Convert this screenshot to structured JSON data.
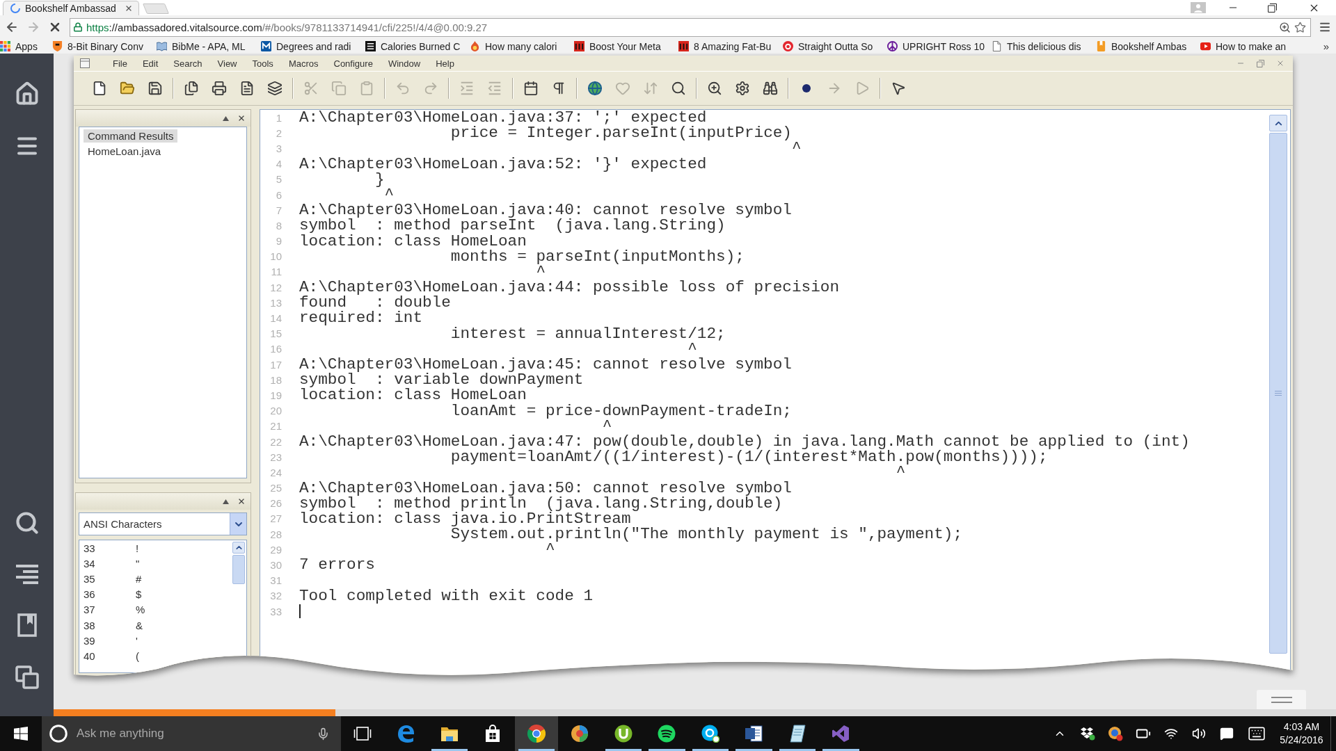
{
  "browser": {
    "tabs": [
      {
        "title": "Bookshelf Ambassad",
        "selected": true,
        "loading": true
      }
    ],
    "url": {
      "scheme": "https",
      "host": "://ambassadored.vitalsource.com",
      "path": "/#/books/9781133714941/cfi/225!/4/4@0.00:9.27"
    },
    "bookmarks": [
      {
        "kind": "apps",
        "label": "Apps"
      },
      {
        "kind": "site",
        "label": "8-Bit Binary Conv"
      },
      {
        "kind": "site",
        "label": "BibMe - APA, ML"
      },
      {
        "kind": "site",
        "label": "Degrees and radi"
      },
      {
        "kind": "site",
        "label": "Calories Burned C"
      },
      {
        "kind": "site",
        "label": "How many calori"
      },
      {
        "kind": "site",
        "label": "Boost Your Meta"
      },
      {
        "kind": "site",
        "label": "8 Amazing Fat-Bu"
      },
      {
        "kind": "site",
        "label": "Straight Outta So"
      },
      {
        "kind": "site",
        "label": "UPRIGHT Ross 10"
      },
      {
        "kind": "site",
        "label": "This delicious dis"
      },
      {
        "kind": "site",
        "label": "Bookshelf Ambas"
      },
      {
        "kind": "site",
        "label": "How to make an"
      }
    ],
    "bookmarks_overflow": "»"
  },
  "reader": {
    "progress": {
      "level": 0.22
    }
  },
  "ide": {
    "menu": [
      "File",
      "Edit",
      "Search",
      "View",
      "Tools",
      "Macros",
      "Configure",
      "Window",
      "Help"
    ],
    "toolbar_groups": [
      [
        {
          "disabled": false
        },
        {
          "disabled": false
        },
        {
          "disabled": false
        }
      ],
      [
        {
          "disabled": false
        },
        {
          "disabled": false
        },
        {
          "disabled": false
        },
        {
          "disabled": false
        }
      ],
      [
        {
          "disabled": true
        },
        {
          "disabled": true
        },
        {
          "disabled": true
        }
      ],
      [
        {
          "disabled": true
        },
        {
          "disabled": true
        }
      ],
      [
        {
          "disabled": true
        },
        {
          "disabled": true
        }
      ],
      [
        {
          "disabled": false
        },
        {
          "disabled": false
        }
      ],
      [
        {
          "disabled": false
        },
        {
          "disabled": true
        },
        {
          "disabled": true
        },
        {
          "disabled": false
        }
      ],
      [
        {
          "disabled": false
        },
        {
          "disabled": false
        },
        {
          "disabled": false
        }
      ],
      [
        {
          "disabled": false
        },
        {
          "disabled": true
        },
        {
          "disabled": true
        }
      ],
      [
        {
          "disabled": false
        }
      ]
    ],
    "file_view": {
      "items": [
        {
          "label": "Command Results",
          "selected": true
        },
        {
          "label": "HomeLoan.java",
          "selected": false
        }
      ]
    },
    "character_map": {
      "selector": "ANSI Characters",
      "rows": [
        {
          "code": "33",
          "char": "!"
        },
        {
          "code": "34",
          "char": "\""
        },
        {
          "code": "35",
          "char": "#"
        },
        {
          "code": "36",
          "char": "$"
        },
        {
          "code": "37",
          "char": "%"
        },
        {
          "code": "38",
          "char": "&"
        },
        {
          "code": "39",
          "char": "'"
        },
        {
          "code": "40",
          "char": "("
        }
      ]
    },
    "output": {
      "lines": [
        {
          "number": "1",
          "text": "A:\\Chapter03\\HomeLoan.java:37: ';' expected",
          "cursor": false
        },
        {
          "number": "2",
          "text": "                price = Integer.parseInt(inputPrice)",
          "cursor": false
        },
        {
          "number": "3",
          "text": "                                                    ^",
          "cursor": false
        },
        {
          "number": "4",
          "text": "A:\\Chapter03\\HomeLoan.java:52: '}' expected",
          "cursor": false
        },
        {
          "number": "5",
          "text": "        }",
          "cursor": false
        },
        {
          "number": "6",
          "text": "         ^",
          "cursor": false
        },
        {
          "number": "7",
          "text": "A:\\Chapter03\\HomeLoan.java:40: cannot resolve symbol",
          "cursor": false
        },
        {
          "number": "8",
          "text": "symbol  : method parseInt  (java.lang.String)",
          "cursor": false
        },
        {
          "number": "9",
          "text": "location: class HomeLoan",
          "cursor": false
        },
        {
          "number": "10",
          "text": "                months = parseInt(inputMonths);",
          "cursor": false
        },
        {
          "number": "11",
          "text": "                         ^",
          "cursor": false
        },
        {
          "number": "12",
          "text": "A:\\Chapter03\\HomeLoan.java:44: possible loss of precision",
          "cursor": false
        },
        {
          "number": "13",
          "text": "found   : double",
          "cursor": false
        },
        {
          "number": "14",
          "text": "required: int",
          "cursor": false
        },
        {
          "number": "15",
          "text": "                interest = annualInterest/12;",
          "cursor": false
        },
        {
          "number": "16",
          "text": "                                         ^",
          "cursor": false
        },
        {
          "number": "17",
          "text": "A:\\Chapter03\\HomeLoan.java:45: cannot resolve symbol",
          "cursor": false
        },
        {
          "number": "18",
          "text": "symbol  : variable downPayment",
          "cursor": false
        },
        {
          "number": "19",
          "text": "location: class HomeLoan",
          "cursor": false
        },
        {
          "number": "20",
          "text": "                loanAmt = price-downPayment-tradeIn;",
          "cursor": false
        },
        {
          "number": "21",
          "text": "                                ^",
          "cursor": false
        },
        {
          "number": "22",
          "text": "A:\\Chapter03\\HomeLoan.java:47: pow(double,double) in java.lang.Math cannot be applied to (int)",
          "cursor": false
        },
        {
          "number": "23",
          "text": "                payment=loanAmt/((1/interest)-(1/(interest*Math.pow(months))));",
          "cursor": false
        },
        {
          "number": "24",
          "text": "                                                               ^",
          "cursor": false
        },
        {
          "number": "25",
          "text": "A:\\Chapter03\\HomeLoan.java:50: cannot resolve symbol",
          "cursor": false
        },
        {
          "number": "26",
          "text": "symbol  : method println  (java.lang.String,double)",
          "cursor": false
        },
        {
          "number": "27",
          "text": "location: class java.io.PrintStream",
          "cursor": false
        },
        {
          "number": "28",
          "text": "                System.out.println(\"The monthly payment is \",payment);",
          "cursor": false
        },
        {
          "number": "29",
          "text": "                          ^",
          "cursor": false
        },
        {
          "number": "30",
          "text": "7 errors",
          "cursor": false
        },
        {
          "number": "31",
          "cursor": false
        },
        {
          "number": "32",
          "text": "Tool completed with exit code 1",
          "cursor": false
        },
        {
          "number": "33",
          "cursor": true
        }
      ]
    }
  },
  "taskbar": {
    "search": {
      "placeholder": "Ask me anything"
    },
    "apps": [
      {
        "running": false,
        "selected": false
      },
      {
        "running": true,
        "selected": false
      },
      {
        "running": false,
        "selected": false
      },
      {
        "running": true,
        "selected": true
      },
      {
        "running": false,
        "selected": false
      },
      {
        "running": true,
        "selected": false
      },
      {
        "running": true,
        "selected": false
      },
      {
        "running": true,
        "selected": false
      },
      {
        "running": true,
        "selected": false
      },
      {
        "running": true,
        "selected": false
      },
      {
        "running": true,
        "selected": false
      }
    ],
    "clock": {
      "time": "4:03 AM",
      "date": "5/24/2016"
    }
  }
}
